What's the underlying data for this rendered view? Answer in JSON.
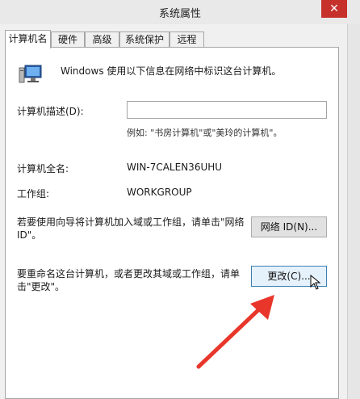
{
  "window": {
    "title": "系统属性",
    "close_label": "✕"
  },
  "tabs": [
    {
      "label": "计算机名",
      "active": true
    },
    {
      "label": "硬件",
      "active": false
    },
    {
      "label": "高级",
      "active": false
    },
    {
      "label": "系统保护",
      "active": false
    },
    {
      "label": "远程",
      "active": false
    }
  ],
  "panel": {
    "intro": "Windows 使用以下信息在网络中标识这台计算机。",
    "description_label": "计算机描述(D):",
    "description_value": "",
    "example": "例如: \"书房计算机\"或\"美玲的计算机\"。",
    "fullname_label": "计算机全名:",
    "fullname_value": "WIN-7CALEN36UHU",
    "workgroup_label": "工作组:",
    "workgroup_value": "WORKGROUP",
    "network_text": "若要使用向导将计算机加入域或工作组，请单击\"网络 ID\"。",
    "network_button": "网络 ID(N)...",
    "rename_text": "要重命名这台计算机，或者更改其域或工作组，请单击\"更改\"。",
    "rename_button": "更改(C)..."
  },
  "icons": {
    "computer": "computer-icon",
    "arrow": "red-arrow-annotation",
    "cursor": "mouse-cursor-icon"
  },
  "colors": {
    "close": "#c7312b",
    "arrow": "#e8362a",
    "hover": "#e5f1fb"
  }
}
